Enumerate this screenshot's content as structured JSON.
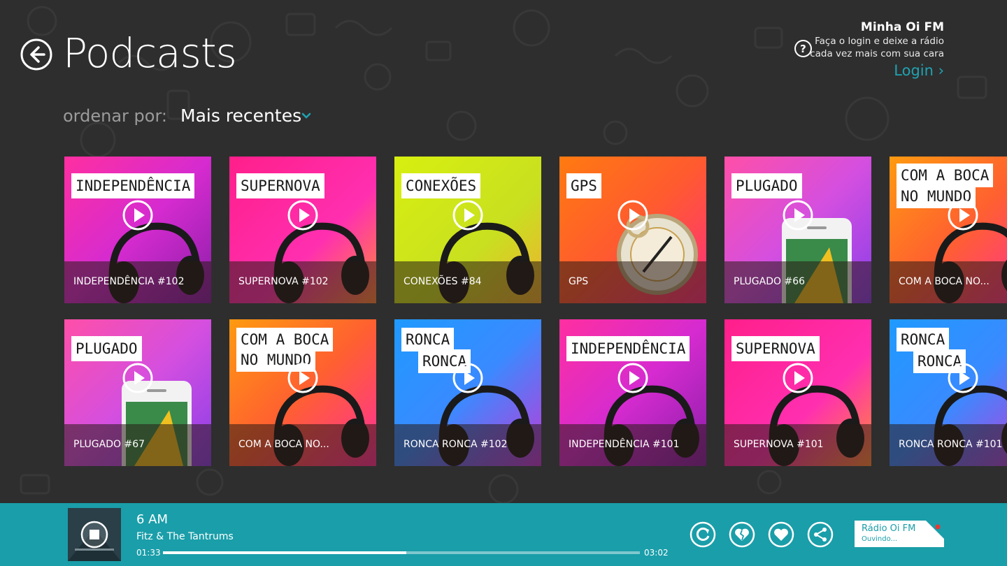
{
  "header": {
    "title": "Podcasts",
    "account_title": "Minha Oi FM",
    "account_desc_line1": "Faça o login e deixe a rádio",
    "account_desc_line2": "cada vez mais com sua cara",
    "login_label": "Login ›"
  },
  "sort": {
    "label": "ordenar por:",
    "value": "Mais recentes"
  },
  "tiles": [
    {
      "art": "INDEPENDÊNCIA",
      "caption": "INDEPENDÊNCIA #102"
    },
    {
      "art": "SUPERNOVA",
      "caption": "SUPERNOVA #102"
    },
    {
      "art": "CONEXÕES",
      "caption": "CONEXÕES #84"
    },
    {
      "art": "GPS",
      "caption": "GPS"
    },
    {
      "art": "PLUGADO",
      "caption": "PLUGADO #66"
    },
    {
      "art1": "COM A BOCA",
      "art2": "NO MUNDO",
      "caption": "COM A BOCA NO..."
    },
    {
      "art": "PLUGADO",
      "caption": "PLUGADO #67"
    },
    {
      "art1": "COM A BOCA",
      "art2": "NO MUNDO",
      "caption": "COM A BOCA NO..."
    },
    {
      "art1": "RONCA",
      "art2": "RONCA",
      "caption": "RONCA RONCA #102"
    },
    {
      "art": "INDEPENDÊNCIA",
      "caption": "INDEPENDÊNCIA #101"
    },
    {
      "art": "SUPERNOVA",
      "caption": "SUPERNOVA #101"
    },
    {
      "art1": "RONCA",
      "art2": "RONCA",
      "caption": "RONCA RONCA #101"
    }
  ],
  "player": {
    "track_title": "6 AM",
    "artist": "Fitz & The Tantrums",
    "elapsed": "01:33",
    "total": "03:02",
    "progress_fraction": 0.51,
    "radio_name": "Rádio Oi FM",
    "radio_status": "Ouvindo..."
  },
  "colors": {
    "accent": "#1a9ea9",
    "login": "#1fa3b2",
    "background": "#2e2e2e"
  }
}
